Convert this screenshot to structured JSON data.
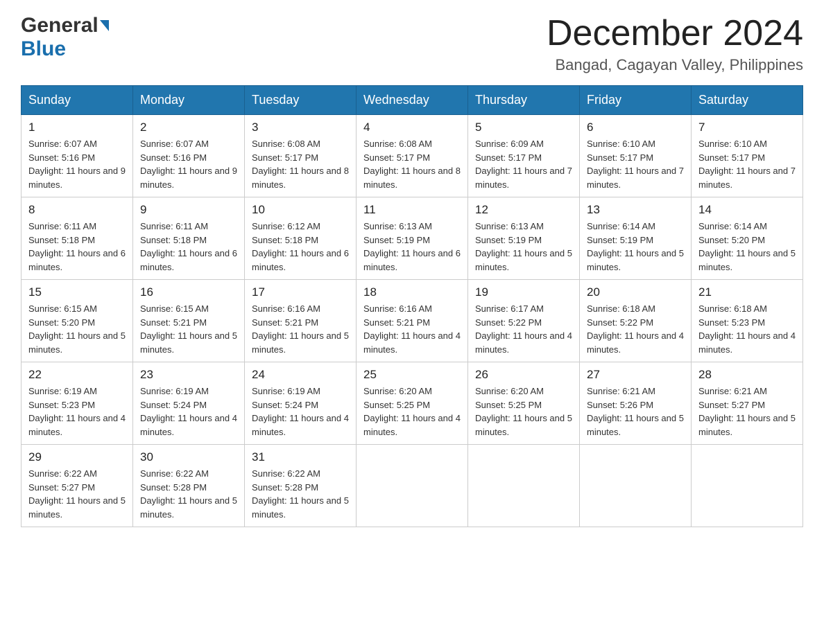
{
  "header": {
    "logo_general": "General",
    "logo_blue": "Blue",
    "month_title": "December 2024",
    "location": "Bangad, Cagayan Valley, Philippines"
  },
  "weekdays": [
    "Sunday",
    "Monday",
    "Tuesday",
    "Wednesday",
    "Thursday",
    "Friday",
    "Saturday"
  ],
  "weeks": [
    [
      {
        "day": "1",
        "sunrise": "6:07 AM",
        "sunset": "5:16 PM",
        "daylight": "11 hours and 9 minutes."
      },
      {
        "day": "2",
        "sunrise": "6:07 AM",
        "sunset": "5:16 PM",
        "daylight": "11 hours and 9 minutes."
      },
      {
        "day": "3",
        "sunrise": "6:08 AM",
        "sunset": "5:17 PM",
        "daylight": "11 hours and 8 minutes."
      },
      {
        "day": "4",
        "sunrise": "6:08 AM",
        "sunset": "5:17 PM",
        "daylight": "11 hours and 8 minutes."
      },
      {
        "day": "5",
        "sunrise": "6:09 AM",
        "sunset": "5:17 PM",
        "daylight": "11 hours and 7 minutes."
      },
      {
        "day": "6",
        "sunrise": "6:10 AM",
        "sunset": "5:17 PM",
        "daylight": "11 hours and 7 minutes."
      },
      {
        "day": "7",
        "sunrise": "6:10 AM",
        "sunset": "5:17 PM",
        "daylight": "11 hours and 7 minutes."
      }
    ],
    [
      {
        "day": "8",
        "sunrise": "6:11 AM",
        "sunset": "5:18 PM",
        "daylight": "11 hours and 6 minutes."
      },
      {
        "day": "9",
        "sunrise": "6:11 AM",
        "sunset": "5:18 PM",
        "daylight": "11 hours and 6 minutes."
      },
      {
        "day": "10",
        "sunrise": "6:12 AM",
        "sunset": "5:18 PM",
        "daylight": "11 hours and 6 minutes."
      },
      {
        "day": "11",
        "sunrise": "6:13 AM",
        "sunset": "5:19 PM",
        "daylight": "11 hours and 6 minutes."
      },
      {
        "day": "12",
        "sunrise": "6:13 AM",
        "sunset": "5:19 PM",
        "daylight": "11 hours and 5 minutes."
      },
      {
        "day": "13",
        "sunrise": "6:14 AM",
        "sunset": "5:19 PM",
        "daylight": "11 hours and 5 minutes."
      },
      {
        "day": "14",
        "sunrise": "6:14 AM",
        "sunset": "5:20 PM",
        "daylight": "11 hours and 5 minutes."
      }
    ],
    [
      {
        "day": "15",
        "sunrise": "6:15 AM",
        "sunset": "5:20 PM",
        "daylight": "11 hours and 5 minutes."
      },
      {
        "day": "16",
        "sunrise": "6:15 AM",
        "sunset": "5:21 PM",
        "daylight": "11 hours and 5 minutes."
      },
      {
        "day": "17",
        "sunrise": "6:16 AM",
        "sunset": "5:21 PM",
        "daylight": "11 hours and 5 minutes."
      },
      {
        "day": "18",
        "sunrise": "6:16 AM",
        "sunset": "5:21 PM",
        "daylight": "11 hours and 4 minutes."
      },
      {
        "day": "19",
        "sunrise": "6:17 AM",
        "sunset": "5:22 PM",
        "daylight": "11 hours and 4 minutes."
      },
      {
        "day": "20",
        "sunrise": "6:18 AM",
        "sunset": "5:22 PM",
        "daylight": "11 hours and 4 minutes."
      },
      {
        "day": "21",
        "sunrise": "6:18 AM",
        "sunset": "5:23 PM",
        "daylight": "11 hours and 4 minutes."
      }
    ],
    [
      {
        "day": "22",
        "sunrise": "6:19 AM",
        "sunset": "5:23 PM",
        "daylight": "11 hours and 4 minutes."
      },
      {
        "day": "23",
        "sunrise": "6:19 AM",
        "sunset": "5:24 PM",
        "daylight": "11 hours and 4 minutes."
      },
      {
        "day": "24",
        "sunrise": "6:19 AM",
        "sunset": "5:24 PM",
        "daylight": "11 hours and 4 minutes."
      },
      {
        "day": "25",
        "sunrise": "6:20 AM",
        "sunset": "5:25 PM",
        "daylight": "11 hours and 4 minutes."
      },
      {
        "day": "26",
        "sunrise": "6:20 AM",
        "sunset": "5:25 PM",
        "daylight": "11 hours and 5 minutes."
      },
      {
        "day": "27",
        "sunrise": "6:21 AM",
        "sunset": "5:26 PM",
        "daylight": "11 hours and 5 minutes."
      },
      {
        "day": "28",
        "sunrise": "6:21 AM",
        "sunset": "5:27 PM",
        "daylight": "11 hours and 5 minutes."
      }
    ],
    [
      {
        "day": "29",
        "sunrise": "6:22 AM",
        "sunset": "5:27 PM",
        "daylight": "11 hours and 5 minutes."
      },
      {
        "day": "30",
        "sunrise": "6:22 AM",
        "sunset": "5:28 PM",
        "daylight": "11 hours and 5 minutes."
      },
      {
        "day": "31",
        "sunrise": "6:22 AM",
        "sunset": "5:28 PM",
        "daylight": "11 hours and 5 minutes."
      },
      null,
      null,
      null,
      null
    ]
  ]
}
